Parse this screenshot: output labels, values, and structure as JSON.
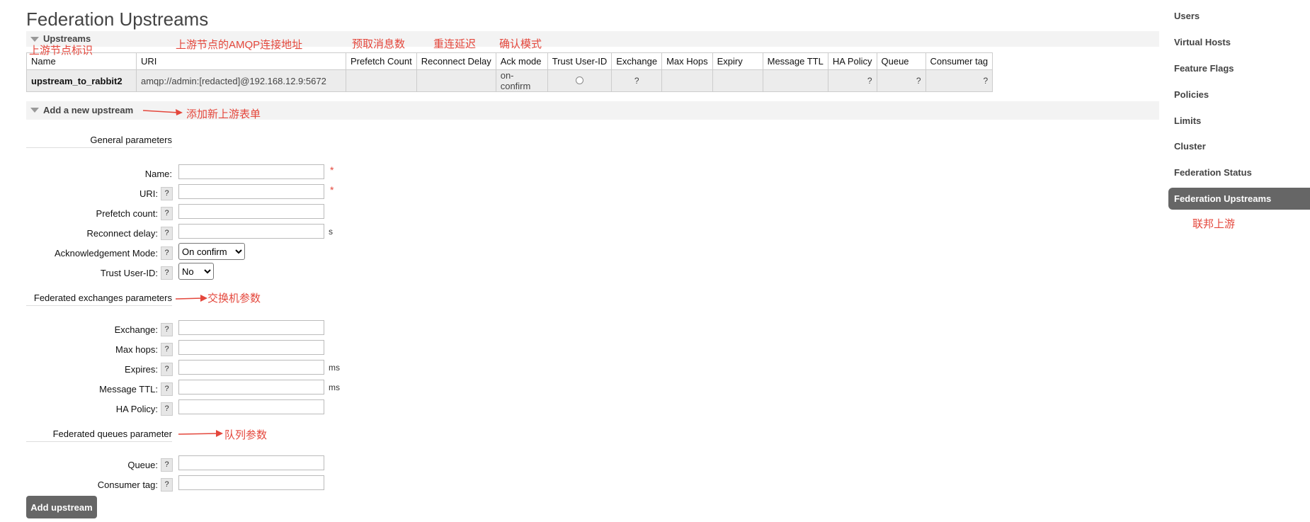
{
  "page_title": "Federation Upstreams",
  "upstreams_section": {
    "title": "Upstreams",
    "columns": [
      "Name",
      "URI",
      "Prefetch Count",
      "Reconnect Delay",
      "Ack mode",
      "Trust User-ID",
      "Exchange",
      "Max Hops",
      "Expiry",
      "Message TTL",
      "HA Policy",
      "Queue",
      "Consumer tag"
    ],
    "rows": [
      {
        "name": "upstream_to_rabbit2",
        "uri": "amqp://admin:[redacted]@192.168.12.9:5672",
        "prefetch": "",
        "reconnect": "",
        "ack_mode": "on-confirm",
        "trust": "",
        "exchange": "?",
        "max_hops": "",
        "expiry": "",
        "ttl": "",
        "ha_policy": "?",
        "queue": "?",
        "consumer_tag": "?"
      }
    ]
  },
  "add_section": {
    "title": "Add a new upstream",
    "general_heading": "General parameters",
    "fields": {
      "name": "Name:",
      "uri": "URI:",
      "prefetch": "Prefetch count:",
      "reconnect": "Reconnect delay:",
      "ack": "Acknowledgement Mode:",
      "trust": "Trust User-ID:"
    },
    "required_mark": "*",
    "help": "?",
    "unit_s": "s",
    "unit_ms": "ms",
    "ack_selected": "On confirm",
    "trust_selected": "No",
    "exchanges_heading": "Federated exchanges parameters",
    "exchange_fields": {
      "exchange": "Exchange:",
      "max_hops": "Max hops:",
      "expires": "Expires:",
      "ttl": "Message TTL:",
      "ha": "HA Policy:"
    },
    "queues_heading": "Federated queues parameter",
    "queue_fields": {
      "queue": "Queue:",
      "consumer_tag": "Consumer tag:"
    },
    "submit": "Add upstream"
  },
  "sidebar": {
    "items": [
      "Users",
      "Virtual Hosts",
      "Feature Flags",
      "Policies",
      "Limits",
      "Cluster",
      "Federation Status"
    ],
    "active": "Federation Upstreams"
  },
  "annotations": {
    "name_id": "上游节点标识",
    "amqp": "上游节点的AMQP连接地址",
    "prefetch": "预取消息数",
    "reconnect": "重连延迟",
    "ack": "确认模式",
    "add_form": "添加新上游表单",
    "exchange_params": "交换机参数",
    "queue_params": "队列参数",
    "fed_upstream": "联邦上游"
  },
  "colors": {
    "annotation": "#e4473c",
    "active_nav": "#666666",
    "button": "#666666"
  }
}
